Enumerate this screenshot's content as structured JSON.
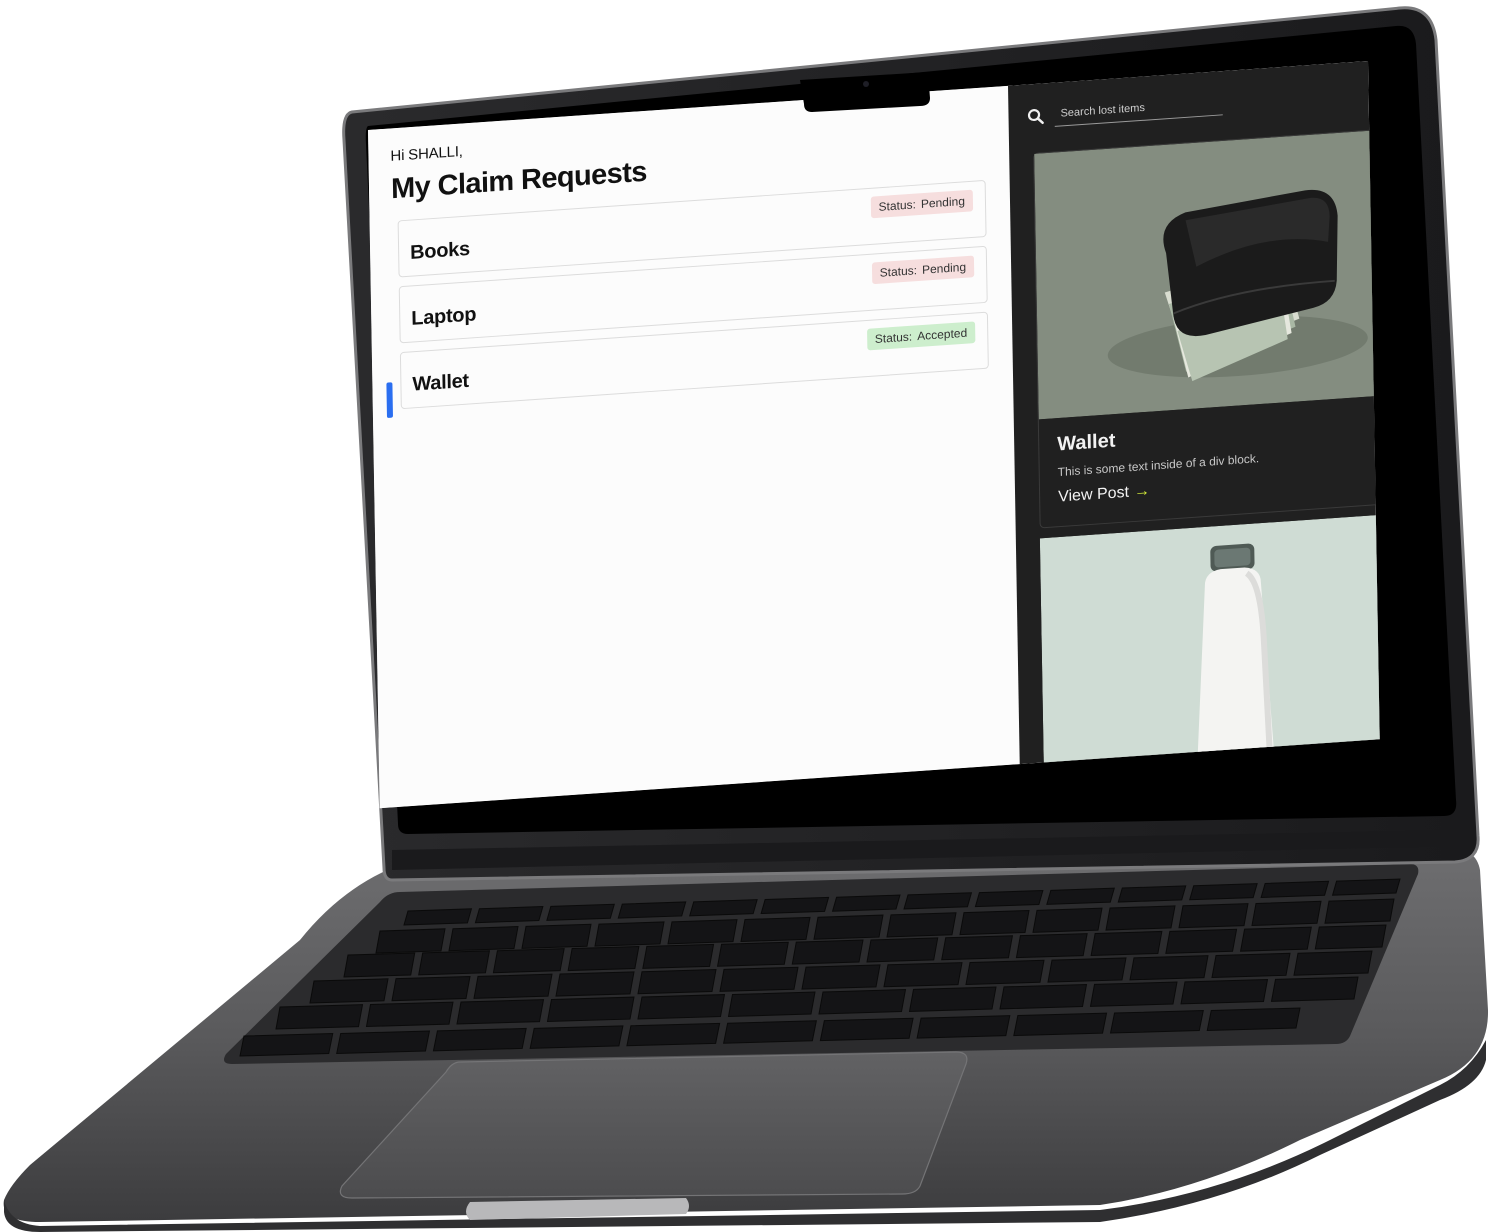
{
  "user": {
    "greeting": "Hi SHALLI,"
  },
  "page": {
    "title": "My Claim Requests"
  },
  "claims": [
    {
      "name": "Books",
      "status_label": "Status:",
      "status": "Pending",
      "status_color": "#f6dede"
    },
    {
      "name": "Laptop",
      "status_label": "Status:",
      "status": "Pending",
      "status_color": "#f6dede"
    },
    {
      "name": "Wallet",
      "status_label": "Status:",
      "status": "Accepted",
      "status_color": "#cdeecd"
    }
  ],
  "sidebar": {
    "search": {
      "placeholder": "Search lost items",
      "icon": "search-icon"
    },
    "items": [
      {
        "title": "Wallet",
        "description": "This is some text inside of a div block.",
        "link_label": "View Post",
        "link_icon": "arrow-right-icon",
        "image": "wallet-photo"
      },
      {
        "image": "water-bottle-photo"
      }
    ]
  },
  "colors": {
    "accent_link_arrow": "#d8f03a",
    "pending_badge": "#f6dede",
    "accepted_badge": "#cdeecd",
    "sidebar_background": "#202020"
  }
}
